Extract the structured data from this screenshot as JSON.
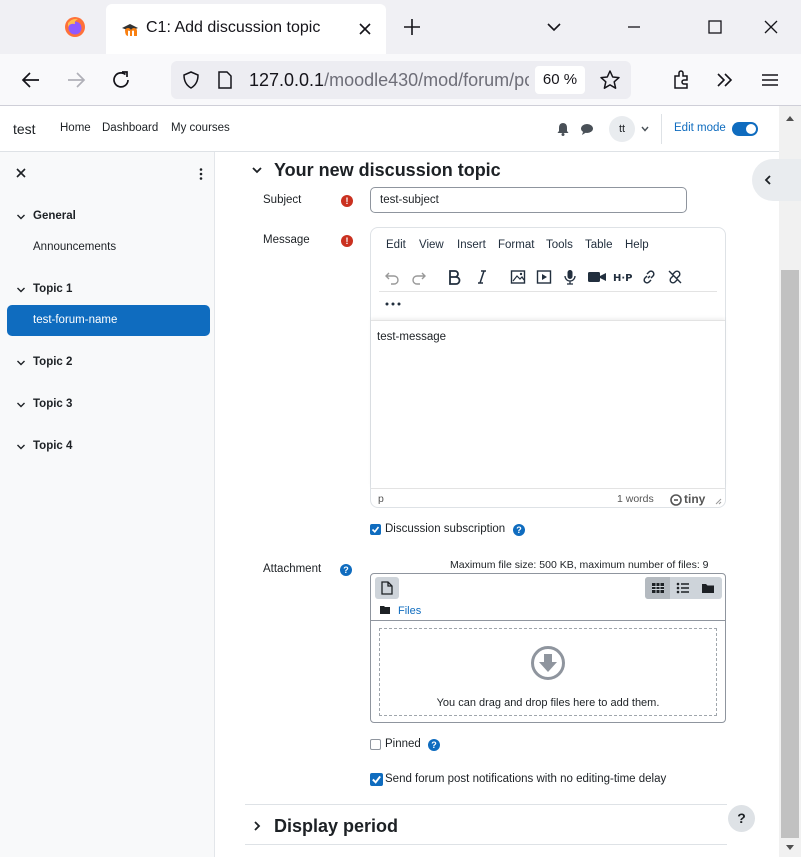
{
  "browser": {
    "tab_title": "C1: Add discussion topic",
    "url_host": "127.0.0.1",
    "url_path": "/moodle430/mod/forum/pc",
    "zoom": "60 %"
  },
  "topbar": {
    "brand": "test",
    "nav": [
      "Home",
      "Dashboard",
      "My courses"
    ],
    "avatar_initials": "tt",
    "edit_mode_label": "Edit mode",
    "edit_mode_on": true
  },
  "drawer": {
    "sections": [
      {
        "title": "General",
        "activities": [
          "Announcements"
        ]
      },
      {
        "title": "Topic 1",
        "activities": [
          "test-forum-name"
        ],
        "active": "test-forum-name"
      },
      {
        "title": "Topic 2",
        "activities": []
      },
      {
        "title": "Topic 3",
        "activities": []
      },
      {
        "title": "Topic 4",
        "activities": []
      }
    ]
  },
  "form": {
    "legend": "Your new discussion topic",
    "subject_label": "Subject",
    "subject_value": "test-subject",
    "message_label": "Message",
    "required_marker": "!",
    "help_marker": "?",
    "editor": {
      "menus": [
        "Edit",
        "View",
        "Insert",
        "Format",
        "Tools",
        "Table",
        "Help"
      ],
      "toolbar_icons": [
        "undo-icon",
        "redo-icon",
        "bold-icon",
        "italic-icon",
        "image-icon",
        "media-icon",
        "record-audio-icon",
        "record-video-icon",
        "h5p-icon",
        "link-icon",
        "unlink-icon"
      ],
      "more_label": "•••",
      "content": "test-message",
      "status_path": "p",
      "word_count": "1 words",
      "brand": "tiny"
    },
    "discussion_subscription": {
      "label": "Discussion subscription",
      "checked": true
    },
    "attachment_label": "Attachment",
    "max_file_info": "Maximum file size: 500 KB, maximum number of files: 9",
    "file_manager": {
      "path_label": "Files",
      "drop_text": "You can drag and drop files here to add them."
    },
    "pinned": {
      "label": "Pinned",
      "checked": false
    },
    "no_delay": {
      "label": "Send forum post notifications with no editing-time delay",
      "checked": true
    },
    "display_period": "Display period"
  },
  "colors": {
    "primary": "#0f6cbf",
    "danger": "#ca3120",
    "text": "#1d2125"
  }
}
